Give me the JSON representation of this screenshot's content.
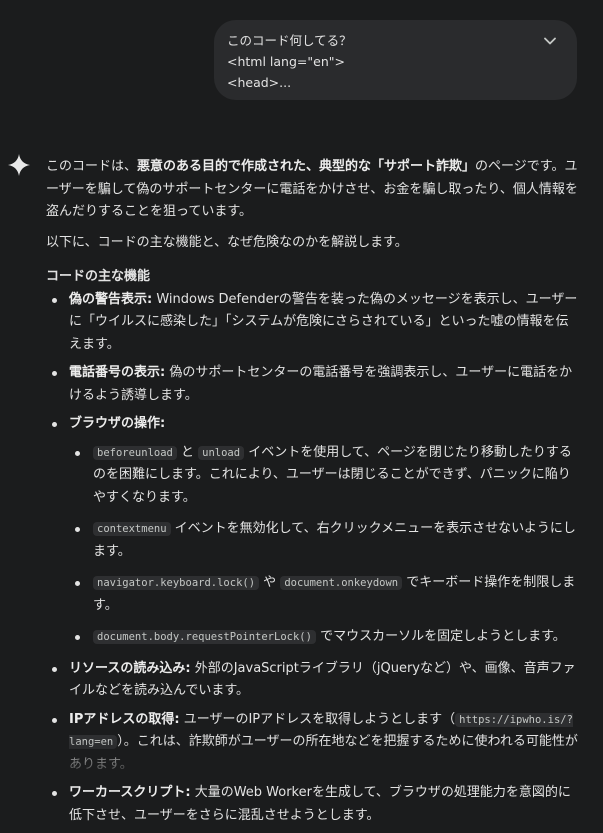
{
  "user_message": {
    "lines": [
      "このコード何してる？",
      "<html lang=\"en\">",
      "<head>..."
    ],
    "expand_icon": "chevron-down-icon"
  },
  "assistant_icon": "gemini-sparkle-icon",
  "response": {
    "intro_a": "このコードは、",
    "intro_b": "悪意のある目的で作成された、典型的な「サポート詐欺」",
    "intro_c": "のページです。ユーザーを騙して偽のサポートセンターに電話をかけさせ、お金を騙し取ったり、個人情報を盗んだりすることを狙っています。",
    "p2": "以下に、コードの主な機能と、なぜ危険なのかを解説します。",
    "heading": "コードの主な機能",
    "item1_title": "偽の警告表示:",
    "item1_text": " Windows Defenderの警告を装った偽のメッセージを表示し、ユーザーに「ウイルスに感染した」「システムが危険にさらされている」といった嘘の情報を伝えます。",
    "item2_title": "電話番号の表示:",
    "item2_text": " 偽のサポートセンターの電話番号を強調表示し、ユーザーに電話をかけるよう誘導します。",
    "item3_title": "ブラウザの操作:",
    "sub1_code1": "beforeunload",
    "sub1_mid": " と ",
    "sub1_code2": "unload",
    "sub1_text": " イベントを使用して、ページを閉じたり移動したりするのを困難にします。これにより、ユーザーは閉じることができず、パニックに陥りやすくなります。",
    "sub2_code": "contextmenu",
    "sub2_text": " イベントを無効化して、右クリックメニューを表示させないようにします。",
    "sub3_code1": "navigator.keyboard.lock()",
    "sub3_mid": " や ",
    "sub3_code2": "document.onkeydown",
    "sub3_text": " でキーボード操作を制限します。",
    "sub4_code": "document.body.requestPointerLock()",
    "sub4_text": " でマウスカーソルを固定しようとします。",
    "item4_title": "リソースの読み込み:",
    "item4_text": " 外部のJavaScriptライブラリ（jQueryなど）や、画像、音声ファイルなどを読み込んでいます。",
    "item5_title": "IPアドレスの取得:",
    "item5_text_a": " ユーザーのIPアドレスを取得しようとします（",
    "item5_code": "https://ipwho.is/?lang=en",
    "item5_text_b": "）。これは、詐欺師がユーザーの所在地などを把握するために使われる可能性があります。",
    "item6_title": "ワーカースクリプト:",
    "item6_text": " 大量のWeb Workerを生成して、ブラウザの処理能力を意図的に低下させ、ユーザーをさらに混乱させようとします。"
  }
}
